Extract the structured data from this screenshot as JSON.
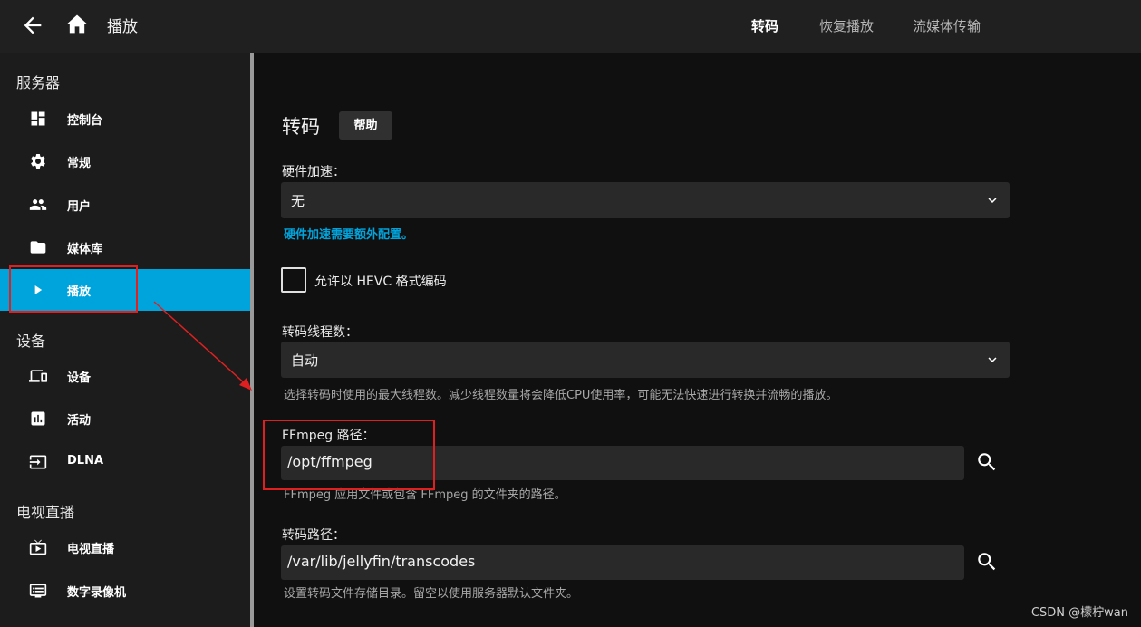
{
  "header": {
    "title": "播放",
    "tabs": [
      {
        "label": "转码",
        "active": true
      },
      {
        "label": "恢复播放",
        "active": false
      },
      {
        "label": "流媒体传输",
        "active": false
      }
    ]
  },
  "sidebar": {
    "sections": [
      {
        "title": "服务器",
        "items": [
          {
            "label": "控制台",
            "icon": "dashboard-icon"
          },
          {
            "label": "常规",
            "icon": "gear-icon"
          },
          {
            "label": "用户",
            "icon": "users-icon"
          },
          {
            "label": "媒体库",
            "icon": "folder-icon"
          },
          {
            "label": "播放",
            "icon": "play-icon",
            "active": true
          }
        ]
      },
      {
        "title": "设备",
        "items": [
          {
            "label": "设备",
            "icon": "devices-icon"
          },
          {
            "label": "活动",
            "icon": "activity-chart-icon"
          },
          {
            "label": "DLNA",
            "icon": "input-icon"
          }
        ]
      },
      {
        "title": "电视直播",
        "items": [
          {
            "label": "电视直播",
            "icon": "live-tv-icon"
          },
          {
            "label": "数字录像机",
            "icon": "dvr-icon"
          }
        ]
      }
    ]
  },
  "main": {
    "title": "转码",
    "help_label": "帮助",
    "hw_accel": {
      "label": "硬件加速：",
      "value": "无",
      "hint": "硬件加速需要额外配置。"
    },
    "hevc": {
      "label": "允许以 HEVC 格式编码",
      "checked": false
    },
    "threads": {
      "label": "转码线程数：",
      "value": "自动",
      "hint": "选择转码时使用的最大线程数。减少线程数量将会降低CPU使用率，可能无法快速进行转换并流畅的播放。"
    },
    "ffmpeg_path": {
      "label": "FFmpeg 路径：",
      "value": "/opt/ffmpeg",
      "hint": "FFmpeg 应用文件或包含 FFmpeg 的文件夹的路径。"
    },
    "transcode_path": {
      "label": "转码路径：",
      "value": "/var/lib/jellyfin/transcodes",
      "hint": "设置转码文件存储目录。留空以使用服务器默认文件夹。"
    }
  },
  "watermark": "CSDN @檬柠wan",
  "colors": {
    "accent": "#00a4dc",
    "annotation": "#e02020"
  }
}
